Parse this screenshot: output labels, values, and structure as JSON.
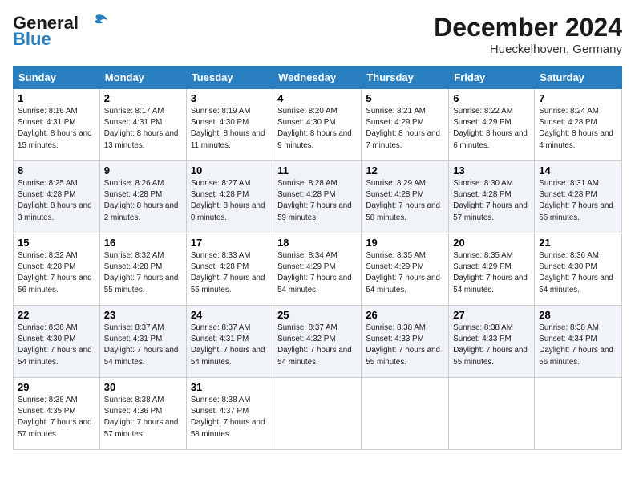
{
  "header": {
    "logo_line1": "General",
    "logo_line2": "Blue",
    "month": "December 2024",
    "location": "Hueckelhoven, Germany"
  },
  "weekdays": [
    "Sunday",
    "Monday",
    "Tuesday",
    "Wednesday",
    "Thursday",
    "Friday",
    "Saturday"
  ],
  "weeks": [
    [
      {
        "day": "1",
        "sunrise": "8:16 AM",
        "sunset": "4:31 PM",
        "daylight": "8 hours and 15 minutes."
      },
      {
        "day": "2",
        "sunrise": "8:17 AM",
        "sunset": "4:31 PM",
        "daylight": "8 hours and 13 minutes."
      },
      {
        "day": "3",
        "sunrise": "8:19 AM",
        "sunset": "4:30 PM",
        "daylight": "8 hours and 11 minutes."
      },
      {
        "day": "4",
        "sunrise": "8:20 AM",
        "sunset": "4:30 PM",
        "daylight": "8 hours and 9 minutes."
      },
      {
        "day": "5",
        "sunrise": "8:21 AM",
        "sunset": "4:29 PM",
        "daylight": "8 hours and 7 minutes."
      },
      {
        "day": "6",
        "sunrise": "8:22 AM",
        "sunset": "4:29 PM",
        "daylight": "8 hours and 6 minutes."
      },
      {
        "day": "7",
        "sunrise": "8:24 AM",
        "sunset": "4:28 PM",
        "daylight": "8 hours and 4 minutes."
      }
    ],
    [
      {
        "day": "8",
        "sunrise": "8:25 AM",
        "sunset": "4:28 PM",
        "daylight": "8 hours and 3 minutes."
      },
      {
        "day": "9",
        "sunrise": "8:26 AM",
        "sunset": "4:28 PM",
        "daylight": "8 hours and 2 minutes."
      },
      {
        "day": "10",
        "sunrise": "8:27 AM",
        "sunset": "4:28 PM",
        "daylight": "8 hours and 0 minutes."
      },
      {
        "day": "11",
        "sunrise": "8:28 AM",
        "sunset": "4:28 PM",
        "daylight": "7 hours and 59 minutes."
      },
      {
        "day": "12",
        "sunrise": "8:29 AM",
        "sunset": "4:28 PM",
        "daylight": "7 hours and 58 minutes."
      },
      {
        "day": "13",
        "sunrise": "8:30 AM",
        "sunset": "4:28 PM",
        "daylight": "7 hours and 57 minutes."
      },
      {
        "day": "14",
        "sunrise": "8:31 AM",
        "sunset": "4:28 PM",
        "daylight": "7 hours and 56 minutes."
      }
    ],
    [
      {
        "day": "15",
        "sunrise": "8:32 AM",
        "sunset": "4:28 PM",
        "daylight": "7 hours and 56 minutes."
      },
      {
        "day": "16",
        "sunrise": "8:32 AM",
        "sunset": "4:28 PM",
        "daylight": "7 hours and 55 minutes."
      },
      {
        "day": "17",
        "sunrise": "8:33 AM",
        "sunset": "4:28 PM",
        "daylight": "7 hours and 55 minutes."
      },
      {
        "day": "18",
        "sunrise": "8:34 AM",
        "sunset": "4:29 PM",
        "daylight": "7 hours and 54 minutes."
      },
      {
        "day": "19",
        "sunrise": "8:35 AM",
        "sunset": "4:29 PM",
        "daylight": "7 hours and 54 minutes."
      },
      {
        "day": "20",
        "sunrise": "8:35 AM",
        "sunset": "4:29 PM",
        "daylight": "7 hours and 54 minutes."
      },
      {
        "day": "21",
        "sunrise": "8:36 AM",
        "sunset": "4:30 PM",
        "daylight": "7 hours and 54 minutes."
      }
    ],
    [
      {
        "day": "22",
        "sunrise": "8:36 AM",
        "sunset": "4:30 PM",
        "daylight": "7 hours and 54 minutes."
      },
      {
        "day": "23",
        "sunrise": "8:37 AM",
        "sunset": "4:31 PM",
        "daylight": "7 hours and 54 minutes."
      },
      {
        "day": "24",
        "sunrise": "8:37 AM",
        "sunset": "4:31 PM",
        "daylight": "7 hours and 54 minutes."
      },
      {
        "day": "25",
        "sunrise": "8:37 AM",
        "sunset": "4:32 PM",
        "daylight": "7 hours and 54 minutes."
      },
      {
        "day": "26",
        "sunrise": "8:38 AM",
        "sunset": "4:33 PM",
        "daylight": "7 hours and 55 minutes."
      },
      {
        "day": "27",
        "sunrise": "8:38 AM",
        "sunset": "4:33 PM",
        "daylight": "7 hours and 55 minutes."
      },
      {
        "day": "28",
        "sunrise": "8:38 AM",
        "sunset": "4:34 PM",
        "daylight": "7 hours and 56 minutes."
      }
    ],
    [
      {
        "day": "29",
        "sunrise": "8:38 AM",
        "sunset": "4:35 PM",
        "daylight": "7 hours and 57 minutes."
      },
      {
        "day": "30",
        "sunrise": "8:38 AM",
        "sunset": "4:36 PM",
        "daylight": "7 hours and 57 minutes."
      },
      {
        "day": "31",
        "sunrise": "8:38 AM",
        "sunset": "4:37 PM",
        "daylight": "7 hours and 58 minutes."
      },
      null,
      null,
      null,
      null
    ]
  ],
  "labels": {
    "sunrise_prefix": "Sunrise: ",
    "sunset_prefix": "Sunset: ",
    "daylight_prefix": "Daylight: "
  }
}
